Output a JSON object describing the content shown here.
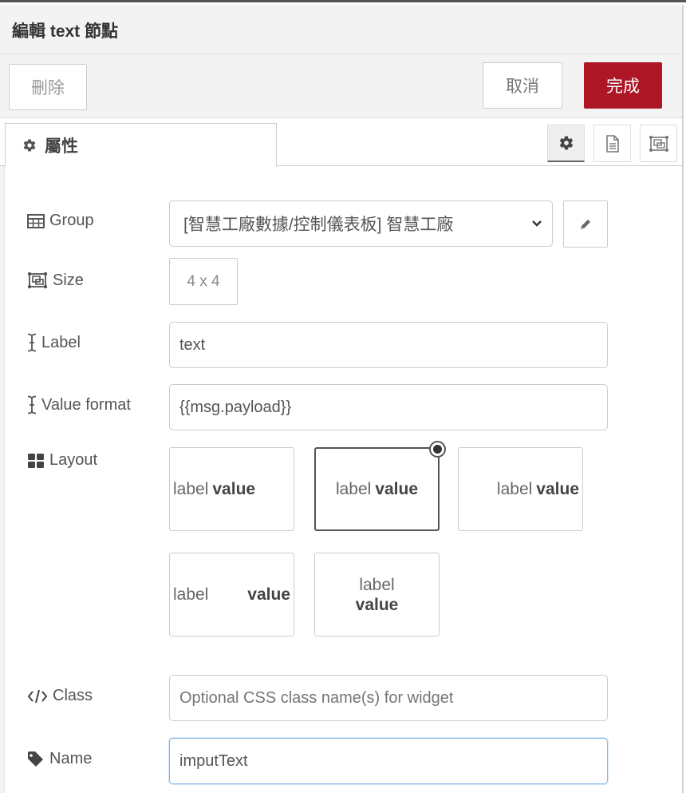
{
  "title": "編輯 text 節點",
  "toolbar": {
    "delete_label": "刪除",
    "cancel_label": "取消",
    "done_label": "完成",
    "done_color": "#ad1625"
  },
  "tabs": {
    "active_label": "屬性",
    "active_icon": "cog-icon",
    "side_buttons": [
      {
        "name": "properties",
        "icon": "cog-icon",
        "selected": true
      },
      {
        "name": "description",
        "icon": "file-text-icon",
        "selected": false
      },
      {
        "name": "appearance",
        "icon": "object-ungroup-icon",
        "selected": false
      }
    ]
  },
  "form": {
    "group": {
      "label": "Group",
      "icon": "table-icon",
      "value": "[智慧工廠數據/控制儀表板] 智慧工廠"
    },
    "size": {
      "label": "Size",
      "icon": "size-icon",
      "value": "4 x 4"
    },
    "label": {
      "label": "Label",
      "icon": "i-cursor-icon",
      "value": "text"
    },
    "value_format": {
      "label": "Value format",
      "icon": "i-cursor-icon",
      "value": "{{msg.payload}}"
    },
    "layout": {
      "label": "Layout",
      "icon": "th-large-icon",
      "selected_index": 1,
      "options": [
        {
          "label": "label",
          "value": "value",
          "align": "left"
        },
        {
          "label": "label",
          "value": "value",
          "align": "center"
        },
        {
          "label": "label",
          "value": "value",
          "align": "right"
        },
        {
          "label": "label",
          "value": "value",
          "align": "spread"
        },
        {
          "label": "label",
          "value": "value",
          "align": "stacked"
        }
      ]
    },
    "class": {
      "label": "Class",
      "icon": "code-icon",
      "value": "",
      "placeholder": "Optional CSS class name(s) for widget"
    },
    "name": {
      "label": "Name",
      "icon": "tag-icon",
      "value": "imputText"
    }
  }
}
